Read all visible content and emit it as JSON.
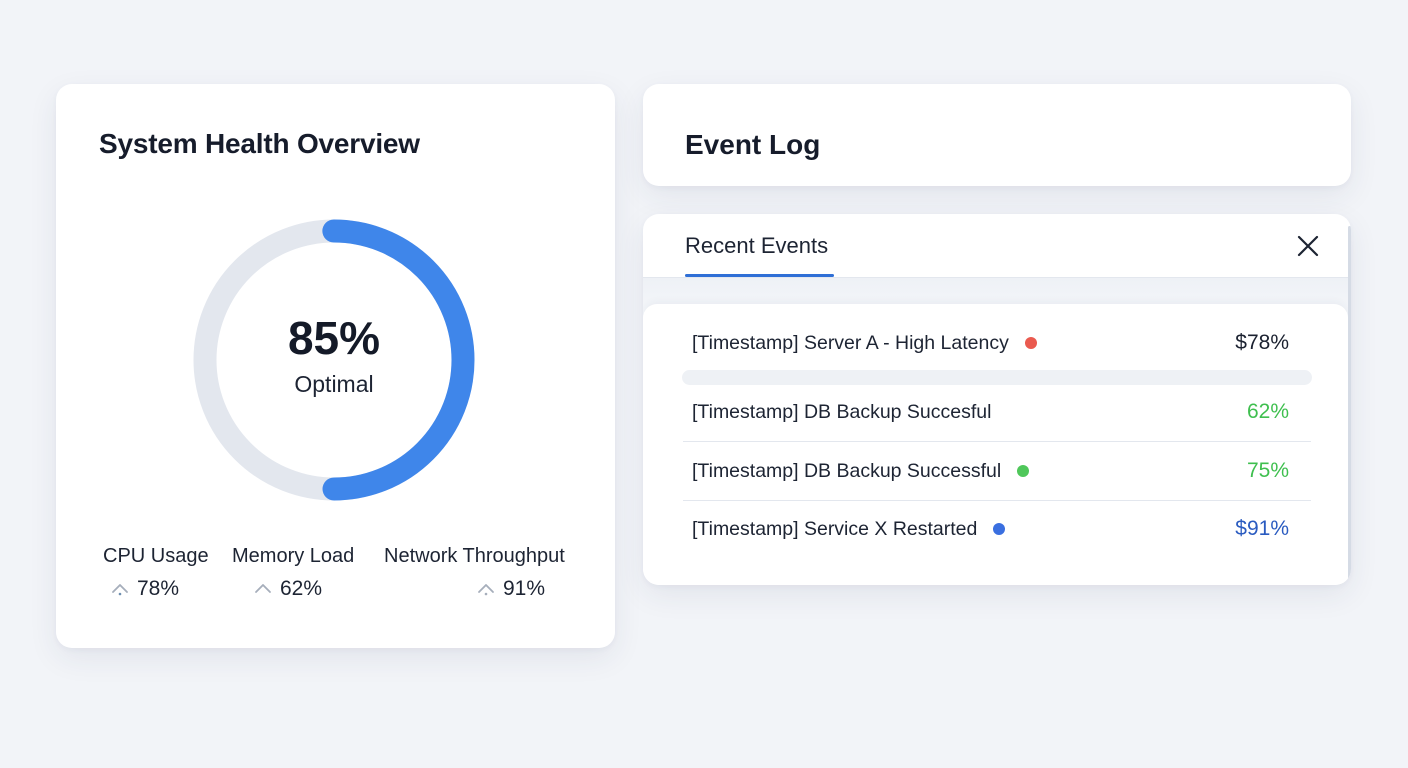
{
  "health": {
    "title": "System Health Overview",
    "gauge": {
      "value_label": "85%",
      "status": "Optimal",
      "fraction": 0.5,
      "color": "#3f86ea",
      "track_color": "#e3e7ee"
    },
    "metrics": [
      {
        "label": "CPU Usage",
        "value": "78%",
        "icon": "arrow-up-icon"
      },
      {
        "label": "Memory Load",
        "value": "62%",
        "icon": "arrow-up-icon"
      },
      {
        "label": "Network Throughput",
        "value": "91%",
        "icon": "arrow-up-icon"
      }
    ]
  },
  "event_log": {
    "title": "Event Log"
  },
  "events": {
    "tab_label": "Recent Events",
    "close_icon": "close-icon",
    "rows": [
      {
        "text": "[Timestamp]  Server A - High Latency",
        "dot": "#ea5a4f",
        "value": "$78%",
        "value_color": "#1b2130"
      },
      {
        "text": "[Timestamp] DB Backup Succesful",
        "dot": null,
        "value": "62%",
        "value_color": "#3fbf4f"
      },
      {
        "text": "[Timestamp] DB Backup Successful",
        "dot": "#4fc75a",
        "value": "75%",
        "value_color": "#3fbf4f"
      },
      {
        "text": "[Timestamp] Service X Restarted",
        "dot": "#3a6fe0",
        "value": "$91%",
        "value_color": "#2a5bc0"
      }
    ]
  }
}
